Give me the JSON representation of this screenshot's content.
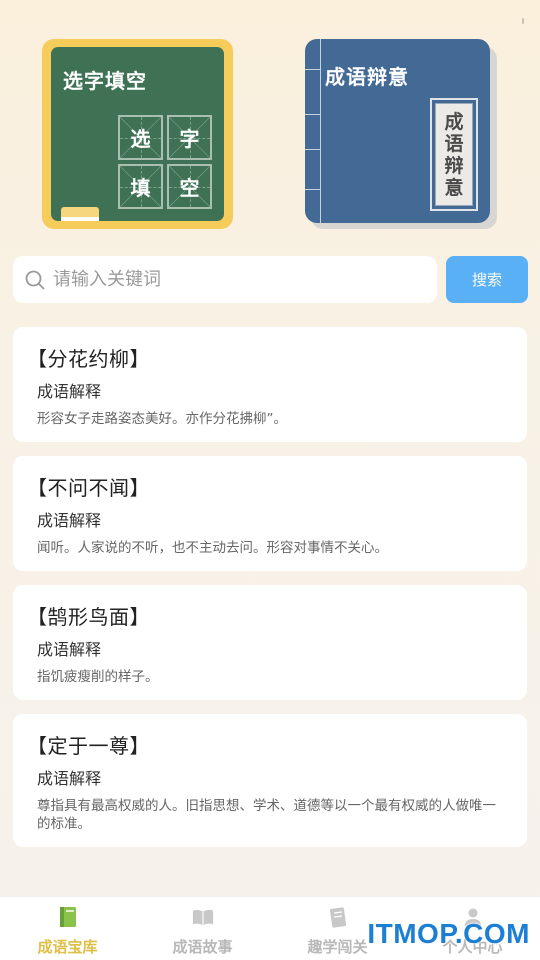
{
  "banner": {
    "card1": {
      "title": "选字填空",
      "grid_chars": [
        "选",
        "字",
        "填",
        "空"
      ]
    },
    "card2": {
      "title": "成语辩意",
      "label_chars": [
        "成",
        "语",
        "辩",
        "意"
      ]
    }
  },
  "search": {
    "placeholder": "请输入关键词",
    "value": "",
    "button_label": "搜索"
  },
  "idioms": [
    {
      "title": "【分花约柳】",
      "explain_label": "成语解释",
      "explain": "形容女子走路姿态美好。亦作分花拂柳”。"
    },
    {
      "title": "【不问不闻】",
      "explain_label": "成语解释",
      "explain": "闻听。人家说的不听，也不主动去问。形容对事情不关心。"
    },
    {
      "title": "【鹄形鸟面】",
      "explain_label": "成语解释",
      "explain": "指饥疲瘦削的样子。"
    },
    {
      "title": "【定于一尊】",
      "explain_label": "成语解释",
      "explain": "尊指具有最高权威的人。旧指思想、学术、道德等以一个最有权威的人做唯一的标准。"
    }
  ],
  "tabbar": {
    "tabs": [
      {
        "label": "成语宝库",
        "icon": "book-green-icon",
        "active": true
      },
      {
        "label": "成语故事",
        "icon": "open-book-icon",
        "active": false
      },
      {
        "label": "趣学闯关",
        "icon": "notebook-icon",
        "active": false
      },
      {
        "label": "个人中心",
        "icon": "person-icon",
        "active": false
      }
    ]
  },
  "watermark": "ITMOP.COM",
  "colors": {
    "accent": "#59b0f5",
    "active_tab": "#e0bf48",
    "board_green": "#3f7254",
    "book_blue": "#436995",
    "card_yellow": "#f6cc5a"
  }
}
